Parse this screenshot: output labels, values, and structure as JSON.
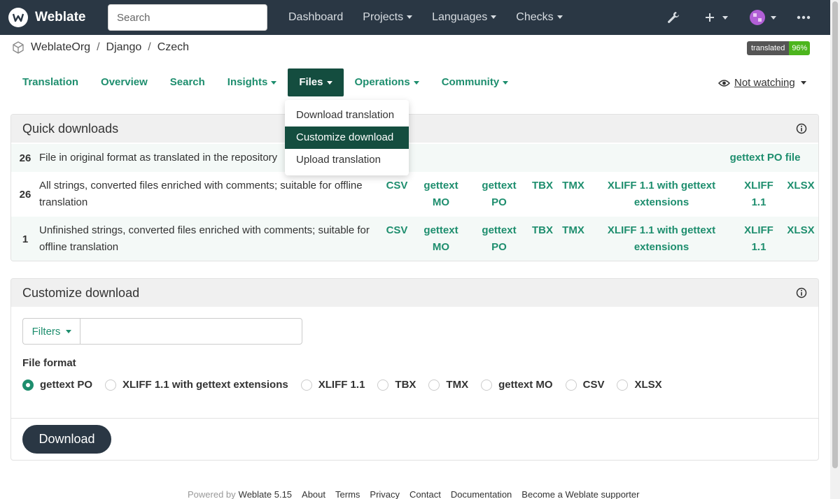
{
  "navbar": {
    "brand": "Weblate",
    "search_placeholder": "Search",
    "links": [
      "Dashboard",
      "Projects",
      "Languages",
      "Checks"
    ]
  },
  "breadcrumb": [
    "WeblateOrg",
    "Django",
    "Czech"
  ],
  "badge": {
    "label": "translated",
    "value": "96%"
  },
  "tabs": [
    "Translation",
    "Overview",
    "Search",
    "Insights",
    "Files",
    "Operations",
    "Community"
  ],
  "watching": "Not watching",
  "files_menu": [
    "Download translation",
    "Customize download",
    "Upload translation"
  ],
  "quick_downloads": {
    "title": "Quick downloads",
    "rows": [
      {
        "count": "26",
        "desc": "File in original format as translated in the repository",
        "links": [
          "gettext PO file"
        ]
      },
      {
        "count": "26",
        "desc": "All strings, converted files enriched with comments; suitable for offline translation",
        "links": [
          "CSV",
          "gettext MO",
          "gettext PO",
          "TBX",
          "TMX",
          "XLIFF 1.1 with gettext extensions",
          "XLIFF 1.1",
          "XLSX"
        ]
      },
      {
        "count": "1",
        "desc": "Unfinished strings, converted files enriched with comments; suitable for offline translation",
        "links": [
          "CSV",
          "gettext MO",
          "gettext PO",
          "TBX",
          "TMX",
          "XLIFF 1.1 with gettext extensions",
          "XLIFF 1.1",
          "XLSX"
        ]
      }
    ]
  },
  "customize": {
    "title": "Customize download",
    "filters_label": "Filters",
    "file_format_label": "File format",
    "formats": [
      "gettext PO",
      "XLIFF 1.1 with gettext extensions",
      "XLIFF 1.1",
      "TBX",
      "TMX",
      "gettext MO",
      "CSV",
      "XLSX"
    ],
    "selected": "gettext PO",
    "download_label": "Download"
  },
  "footer": {
    "powered_by": "Powered by",
    "version": "Weblate 5.15",
    "links": [
      "About",
      "Terms",
      "Privacy",
      "Contact",
      "Documentation",
      "Become a Weblate supporter"
    ]
  },
  "colors": {
    "navbar": "#2a3744",
    "accent": "#1e8e6e",
    "active_tab": "#144d3f",
    "badge_ok": "#4cb51d"
  }
}
